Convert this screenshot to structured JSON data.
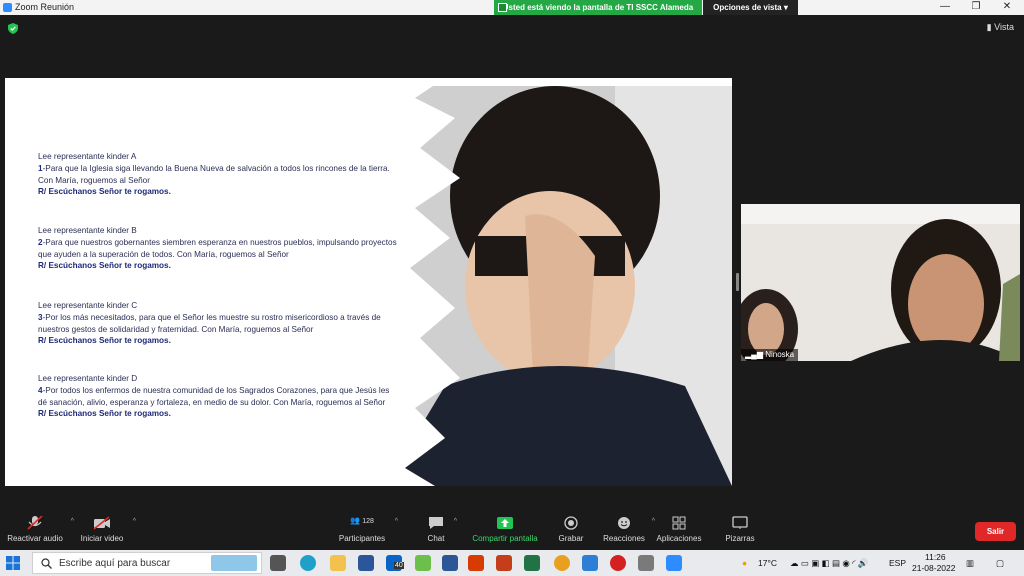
{
  "window": {
    "title": "Zoom Reunión",
    "share_banner": "Usted está viendo la pantalla de TI SSCC Alameda",
    "view_options": "Opciones de vista",
    "minimize": "—",
    "maximize": "❐",
    "close": "✕"
  },
  "meeting": {
    "view_label": "Vista",
    "participant_name": "Ninoska"
  },
  "slide": {
    "blocks": [
      {
        "reader": "Lee representante kinder A",
        "num": "1",
        "text": "-Para que la Iglesia siga llevando la Buena Nueva de salvación a todos los rincones de la tierra. Con María, roguemos al Señor",
        "reply": "R/ Escúchanos Señor te rogamos."
      },
      {
        "reader": "Lee representante kinder B",
        "num": "2",
        "text": "-Para que nuestros gobernantes siembren esperanza en nuestros pueblos, impulsando proyectos que ayuden a la superación de todos. Con María, roguemos al Señor",
        "reply": "R/ Escúchanos Señor te rogamos."
      },
      {
        "reader": "Lee representante kinder C",
        "num": "3",
        "text": "-Por los más necesitados, para que el Señor les muestre su rostro misericordioso a través de nuestros gestos de solidaridad y fraternidad. Con María, roguemos al Señor",
        "reply": "R/ Escúchanos Señor te rogamos."
      },
      {
        "reader": "Lee representante kinder D",
        "num": "4",
        "text": "-Por todos los enfermos de nuestra comunidad de los Sagrados Corazones, para que Jesús les dé sanación, alivio, esperanza y fortaleza, en medio de su dolor. Con María, roguemos al Señor",
        "reply": "R/ Escúchanos Señor te rogamos."
      }
    ]
  },
  "toolbar": {
    "unmute": "Reactivar audio",
    "start_video": "Iniciar video",
    "participants": "Participantes",
    "participants_count": "128",
    "chat": "Chat",
    "share_screen": "Compartir pantalla",
    "record": "Grabar",
    "reactions": "Reacciones",
    "apps": "Aplicaciones",
    "whiteboards": "Pizarras",
    "leave": "Salir"
  },
  "taskbar": {
    "search_placeholder": "Escribe aquí para buscar",
    "mail_badge": "40",
    "temperature": "17°C",
    "language": "ESP",
    "time": "11:26",
    "date": "21-08-2022"
  },
  "colors": {
    "zoom_green": "#23a845",
    "leave_red": "#e02828",
    "slide_text": "#2b2f55"
  }
}
